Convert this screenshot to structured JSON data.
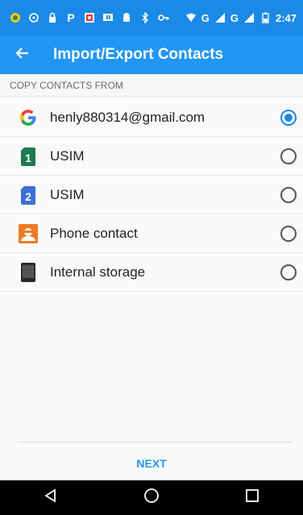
{
  "status_bar": {
    "time": "2:47",
    "icons": [
      "android-debug-icon",
      "sync-icon",
      "lock-icon",
      "p-icon",
      "photo-icon",
      "message-icon",
      "android-icon",
      "bluetooth-icon",
      "key-icon",
      "wifi-icon",
      "signal-g-icon",
      "signal-g-icon",
      "battery-icon"
    ],
    "network_label_1": "G",
    "network_label_2": "G"
  },
  "app_bar": {
    "title": "Import/Export Contacts",
    "back_icon": "arrow-left-icon"
  },
  "section": {
    "header": "COPY CONTACTS FROM"
  },
  "sources": [
    {
      "label": "henly880314@gmail.com",
      "icon": "google-icon",
      "selected": true
    },
    {
      "label": "USIM",
      "icon": "sim1-icon",
      "badge": "1",
      "selected": false
    },
    {
      "label": "USIM",
      "icon": "sim2-icon",
      "badge": "2",
      "selected": false
    },
    {
      "label": "Phone contact",
      "icon": "phone-contact-icon",
      "selected": false
    },
    {
      "label": "Internal storage",
      "icon": "internal-storage-icon",
      "selected": false
    }
  ],
  "footer": {
    "next_label": "NEXT"
  },
  "nav_bar": {
    "icons": [
      "back-triangle-icon",
      "home-circle-icon",
      "recents-square-icon"
    ]
  },
  "colors": {
    "status_bar": "#1a8ae6",
    "app_bar": "#2196f3",
    "accent": "#1e88e5",
    "sim1": "#1b7a4f",
    "sim2": "#3c6fd6",
    "phone_contact": "#f07a24"
  }
}
